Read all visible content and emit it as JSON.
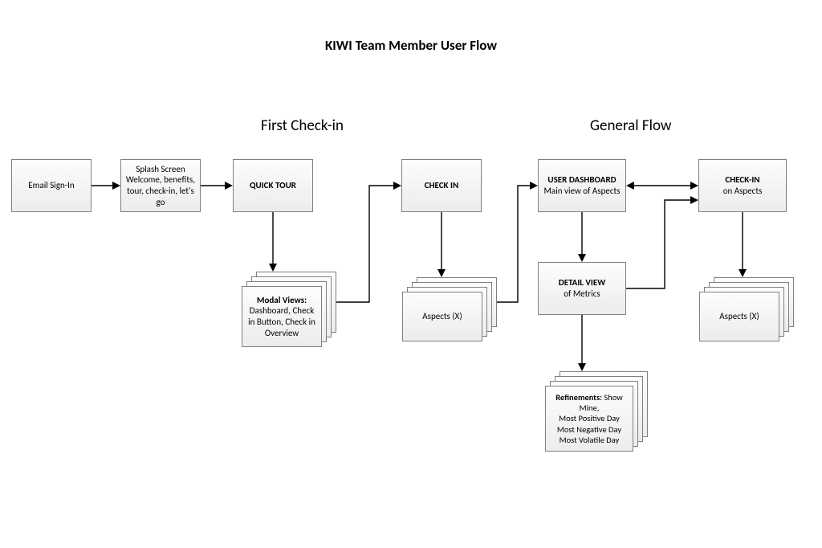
{
  "title": "KIWI Team Member User Flow",
  "sections": {
    "first_checkin": "First Check-in",
    "general_flow": "General Flow"
  },
  "boxes": {
    "email_signin": "Email Sign-In",
    "splash_screen": "Splash Screen Welcome, benefits, tour, check-in, let's go",
    "quick_tour": "QUICK TOUR",
    "modal_views_title": "Modal Views:",
    "modal_views_body": "Dashboard, Check in Button, Check in Overview",
    "check_in": "CHECK IN",
    "aspects_x_1": "Aspects (X)",
    "user_dashboard_title": "USER DASHBOARD",
    "user_dashboard_body": "Main view of Aspects",
    "detail_view_title": "DETAIL VIEW",
    "detail_view_body": "of Metrics",
    "refinements_title": "Refinements:",
    "refinements_body_1": "Show Mine,",
    "refinements_body_2": "Most Positive Day",
    "refinements_body_3": "Most Negative Day",
    "refinements_body_4": "Most Volatile Day",
    "checkin_aspects_title": "CHECK-IN",
    "checkin_aspects_body": "on Aspects",
    "aspects_x_2": "Aspects (X)"
  }
}
